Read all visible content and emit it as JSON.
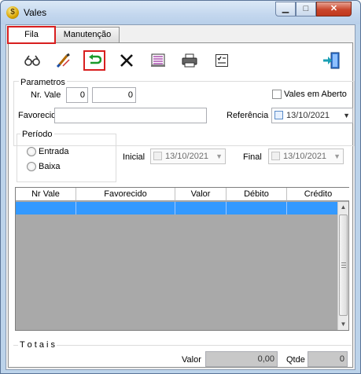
{
  "window": {
    "title": "Vales"
  },
  "tabs": [
    {
      "label": "Fila"
    },
    {
      "label": "Manutenção"
    }
  ],
  "toolbar": {
    "icons": [
      "binoculars-icon",
      "edit-brush-icon",
      "undo-arrow-icon",
      "delete-x-icon",
      "report-icon",
      "printer-icon",
      "checklist-icon",
      "exit-door-icon"
    ]
  },
  "parametros": {
    "legend": "Parametros",
    "nr_vale_label": "Nr. Vale",
    "nr_vale_from": "0",
    "nr_vale_to": "0",
    "vales_em_aberto_label": "Vales em Aberto",
    "favorecido_label": "Favorecido",
    "favorecido_value": "",
    "referencia_label": "Referência",
    "referencia_value": "13/10/2021"
  },
  "periodo": {
    "legend": "Período",
    "options": [
      "Entrada",
      "Baixa"
    ],
    "inicial_label": "Inicial",
    "inicial_value": "13/10/2021",
    "final_label": "Final",
    "final_value": "13/10/2021"
  },
  "grid": {
    "columns": [
      "Nr Vale",
      "Favorecido",
      "Valor",
      "Débito",
      "Crédito"
    ]
  },
  "totais": {
    "legend": "T o t a i s",
    "valor_label": "Valor",
    "valor_value": "0,00",
    "qtde_label": "Qtde",
    "qtde_value": "0"
  },
  "colors": {
    "accent": "#3399ff",
    "highlight": "#d81f1f"
  }
}
